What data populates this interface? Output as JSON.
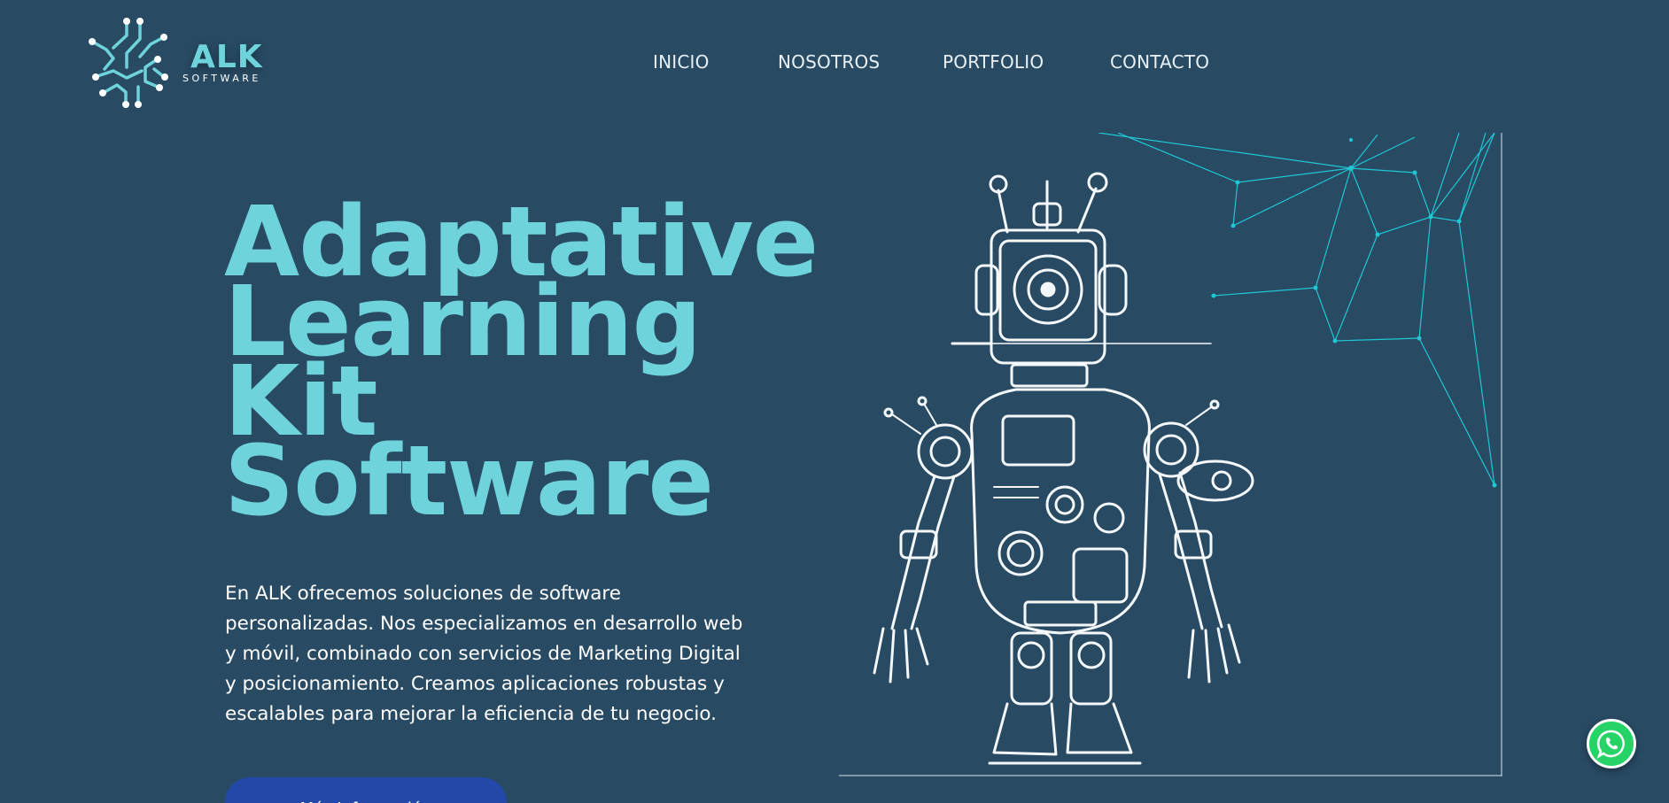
{
  "brand": {
    "name": "ALK",
    "tagline": "SOFTWARE",
    "accent_color": "#6fd3db",
    "background_color": "#284a63",
    "logo_icon": "circuit-logo-icon"
  },
  "nav": {
    "items": [
      {
        "label": "INICIO"
      },
      {
        "label": "NOSOTROS"
      },
      {
        "label": "PORTFOLIO"
      },
      {
        "label": "CONTACTO"
      }
    ]
  },
  "hero": {
    "title_lines": [
      "Adaptative",
      "Learning",
      "Kit",
      "Software"
    ],
    "description": "En ALK ofrecemos soluciones de software personalizadas. Nos especializamos en desarrollo web y móvil, combinado con servicios de Marketing Digital y posicionamiento. Creamos aplicaciones robustas y escalables para mejorar la eficiencia de tu negocio.",
    "cta_label": "Más Información",
    "cta_color": "#2348a8",
    "illustration": "robot-illustration"
  },
  "floating": {
    "whatsapp_icon": "whatsapp-icon",
    "whatsapp_color": "#25d366"
  }
}
